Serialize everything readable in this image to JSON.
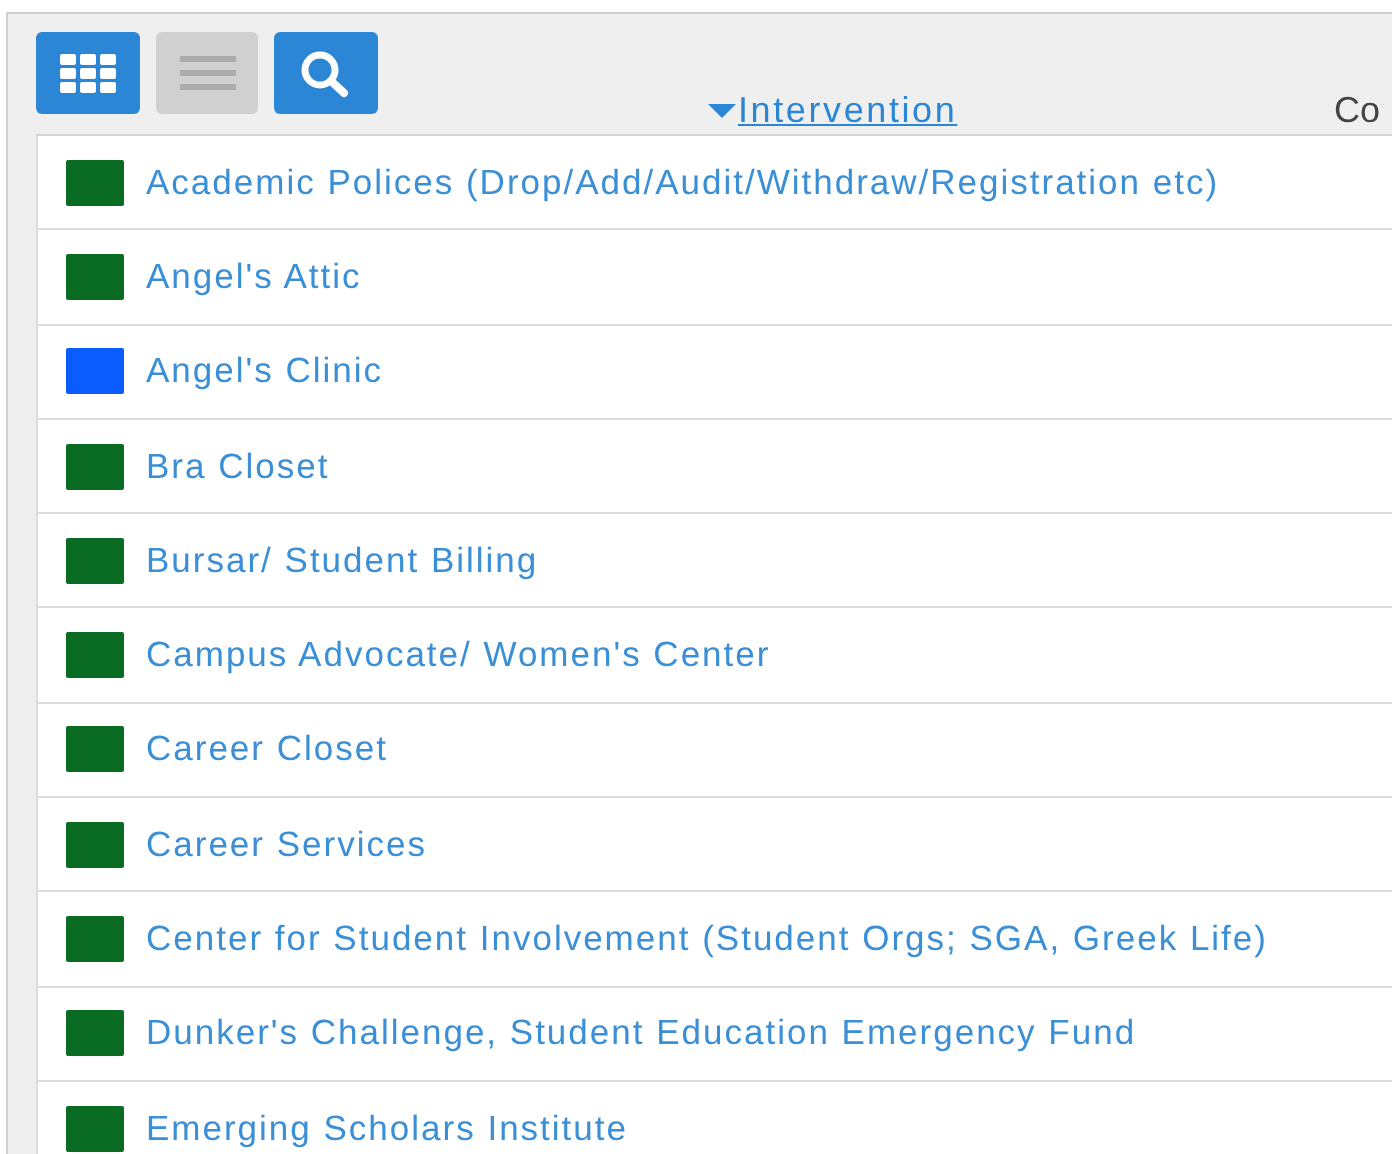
{
  "toolbar": {
    "view_buttons": [
      {
        "kind": "grid",
        "selected": true
      },
      {
        "kind": "list",
        "selected": false
      }
    ]
  },
  "columns": [
    {
      "label": "Intervention",
      "sorted": true
    },
    {
      "label": "Co",
      "sorted": false
    }
  ],
  "rows": [
    {
      "name": "Academic Polices (Drop/Add/Audit/Withdraw/Registration etc)",
      "color": "#0a6b22"
    },
    {
      "name": "Angel's Attic",
      "color": "#0a6b22"
    },
    {
      "name": "Angel's Clinic",
      "color": "#0a5cff"
    },
    {
      "name": "Bra Closet",
      "color": "#0a6b22"
    },
    {
      "name": "Bursar/ Student Billing",
      "color": "#0a6b22"
    },
    {
      "name": "Campus Advocate/ Women's Center",
      "color": "#0a6b22"
    },
    {
      "name": "Career Closet",
      "color": "#0a6b22"
    },
    {
      "name": "Career Services",
      "color": "#0a6b22"
    },
    {
      "name": "Center for Student Involvement (Student Orgs; SGA, Greek Life)",
      "color": "#0a6b22"
    },
    {
      "name": "Dunker's Challenge, Student Education Emergency Fund",
      "color": "#0a6b22"
    },
    {
      "name": "Emerging Scholars Institute",
      "color": "#0a6b22"
    }
  ]
}
